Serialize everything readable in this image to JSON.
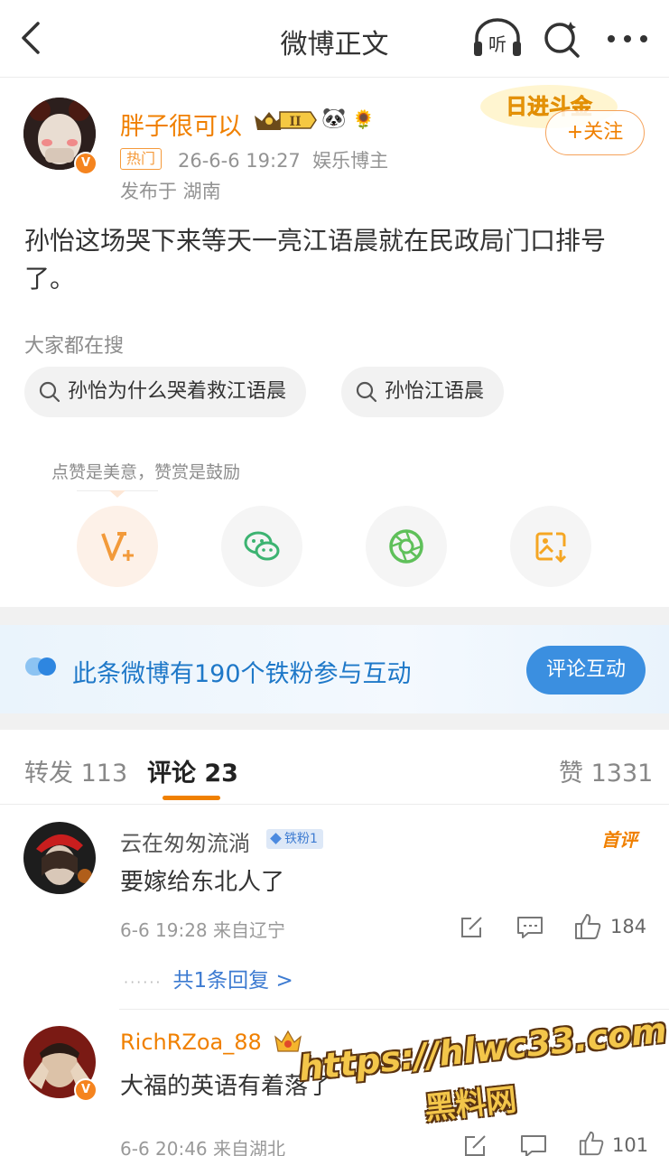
{
  "header": {
    "title": "微博正文",
    "listen_label": "听"
  },
  "author": {
    "name": "胖子很可以",
    "vip_level": "II",
    "hot_badge": "热门",
    "time": "26-6-6 19:27",
    "tag": "娱乐博主",
    "location": "发布于 湖南",
    "follow_label": "+关注",
    "deco_text": "日进斗金"
  },
  "post": {
    "text": "孙怡这场哭下来等天一亮江语晨就在民政局门口排号了。"
  },
  "searches": {
    "label": "大家都在搜",
    "items": [
      "孙怡为什么哭着救江语晨",
      "孙怡江语晨"
    ]
  },
  "reward": {
    "tip": "点赞是美意，赞赏是鼓励"
  },
  "banner": {
    "text": "此条微博有190个铁粉参与互动",
    "button": "评论互动"
  },
  "tabs": {
    "repost": "转发 113",
    "comment": "评论 23",
    "like": "赞 1331"
  },
  "comments": [
    {
      "name": "云在匆匆流淌",
      "fan_badge": "铁粉1",
      "hot_label": "首评",
      "text": "要嫁给东北人了",
      "time": "6-6 19:28  来自辽宁",
      "likes": "184",
      "replies": "共1条回复 >"
    },
    {
      "name": "RichRZoa_88",
      "text": "大福的英语有着落了",
      "time": "6-6 20:46  来自湖北",
      "likes": "101"
    }
  ],
  "watermark": {
    "line1": "https://hlwc33.com",
    "line2": "黑料网"
  },
  "colors": {
    "accent": "#f08000",
    "link": "#3d7bd1",
    "banner_button": "#3b8fe0"
  }
}
